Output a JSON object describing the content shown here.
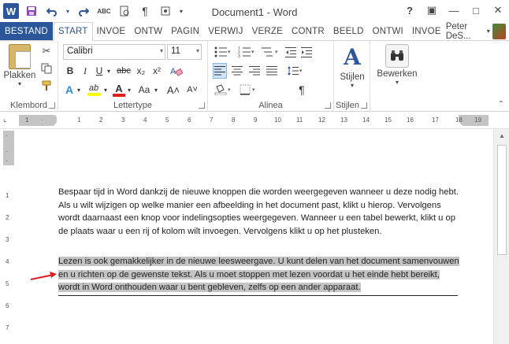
{
  "title_bar": {
    "title": "Document1 - Word",
    "qat_icons": [
      "word-logo-icon",
      "save-icon",
      "undo-icon",
      "redo-icon",
      "spelling-icon",
      "print-preview-icon",
      "paragraph-mark-icon",
      "touch-mode-icon",
      "customize-qat-icon"
    ],
    "word_logo": "W",
    "help": "?",
    "ribbon_options": "▣",
    "minimize": "—",
    "restore": "□",
    "close": "✕"
  },
  "tabs": [
    {
      "label": "BESTAND"
    },
    {
      "label": "START"
    },
    {
      "label": "INVOE"
    },
    {
      "label": "ONTW"
    },
    {
      "label": "PAGIN"
    },
    {
      "label": "VERWIJ"
    },
    {
      "label": "VERZE"
    },
    {
      "label": "CONTR"
    },
    {
      "label": "BEELD"
    },
    {
      "label": "ONTWI"
    },
    {
      "label": "INVOE"
    }
  ],
  "user": {
    "name": "Peter DeS..."
  },
  "ribbon": {
    "clipboard": {
      "label": "Klembord",
      "paste_label": "Plakken"
    },
    "font": {
      "label": "Lettertype",
      "font_name": "Calibri",
      "font_size": "11",
      "bold": "B",
      "italic": "I",
      "underline": "U",
      "strike": "abc",
      "subscript": "x₂",
      "superscript": "x²",
      "text_effects": "A",
      "highlight": "ab",
      "font_color": "A",
      "change_case": "Aa",
      "grow": "A˄",
      "shrink": "A˅"
    },
    "paragraph": {
      "label": "Alinea",
      "show_marks": "¶"
    },
    "styles": {
      "label": "Stijlen",
      "button_label": "Stijlen",
      "icon": "A"
    },
    "editing": {
      "button_label": "Bewerken"
    }
  },
  "document": {
    "paragraph1": "Bespaar tijd in Word dankzij de nieuwe knoppen die worden weergegeven wanneer u deze nodig hebt. Als u wilt wijzigen op welke manier een afbeelding in het document past, klikt u hierop. Vervolgens wordt daarnaast een knop voor indelingsopties weergegeven. Wanneer u een tabel bewerkt, klikt u op de plaats waar u een rij of kolom wilt invoegen. Vervolgens klikt u op het plusteken.",
    "paragraph2": "Lezen is ook gemakkelijker in de nieuwe leesweergave. U kunt delen van het document samenvouwen en u richten op de gewenste tekst. Als u moet stoppen met lezen voordat u het einde hebt bereikt, wordt in Word onthouden waar u bent gebleven, zelfs op een ander apparaat."
  },
  "colors": {
    "accent": "#2b579a",
    "selection": "#c4c4c4",
    "arrow": "#e02020"
  }
}
